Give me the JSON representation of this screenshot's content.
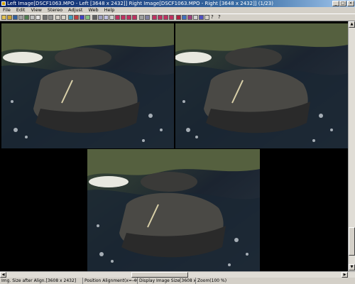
{
  "window": {
    "title": "Left Image[DSCF1063.MPO - Left [3648 x 2432]] Right Image[DSCF1063.MPO - Right [3648 x 2432]] (1/23)",
    "controls": {
      "minimize": "_",
      "maximize": "□",
      "close": "×"
    }
  },
  "menu": [
    "File",
    "Edit",
    "View",
    "Stereo",
    "Adjust",
    "Web",
    "Help"
  ],
  "toolbar": {
    "help_glyph": "?",
    "question_glyph": "?"
  },
  "statusbar": {
    "size_after_align": "Img. Size after Align.[3608 x 2432]",
    "position_alignment": "Position Alignment(x=-40 y=0)",
    "display_size": "Display Image Size[3608 x 2432]",
    "zoom": "Zoom(100 %)"
  },
  "colors": {
    "accent": "#0a246a",
    "chrome": "#d4d0c8",
    "viewport": "#000000"
  }
}
